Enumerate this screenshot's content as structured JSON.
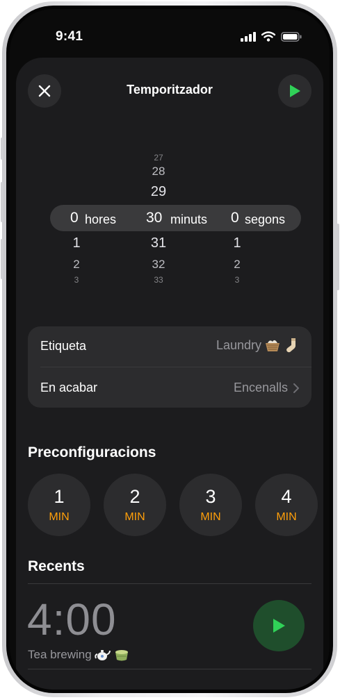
{
  "status_bar": {
    "time": "9:41"
  },
  "header": {
    "title": "Temporitzador"
  },
  "picker": {
    "hours": {
      "above": [
        "",
        "",
        ""
      ],
      "selected": "0",
      "unit": "hores",
      "below": [
        "1",
        "2",
        "3"
      ]
    },
    "minutes": {
      "above": [
        "27",
        "28",
        "29"
      ],
      "selected": "30",
      "unit": "minuts",
      "below": [
        "31",
        "32",
        "33"
      ]
    },
    "seconds": {
      "above": [
        "",
        "",
        ""
      ],
      "selected": "0",
      "unit": "segons",
      "below": [
        "1",
        "2",
        "3"
      ]
    }
  },
  "settings": {
    "label": {
      "title": "Etiqueta",
      "value": "Laundry"
    },
    "when_done": {
      "title": "En acabar",
      "value": "Encenalls"
    }
  },
  "presets": {
    "title": "Preconfiguracions",
    "items": [
      {
        "value": "1",
        "unit": "MIN"
      },
      {
        "value": "2",
        "unit": "MIN"
      },
      {
        "value": "3",
        "unit": "MIN"
      },
      {
        "value": "4",
        "unit": "MIN"
      }
    ]
  },
  "recents": {
    "title": "Recents",
    "items": [
      {
        "time": "4:00",
        "label": "Tea brewing"
      }
    ]
  },
  "colors": {
    "accent_green": "#30d158",
    "accent_orange": "#ff9f0a",
    "sheet_bg": "#1c1c1e"
  },
  "icons": [
    "close-icon",
    "play-icon",
    "chevron-right-icon",
    "teapot-icon",
    "tea-cup-icon",
    "laundry-basket-icon",
    "sock-icon"
  ]
}
